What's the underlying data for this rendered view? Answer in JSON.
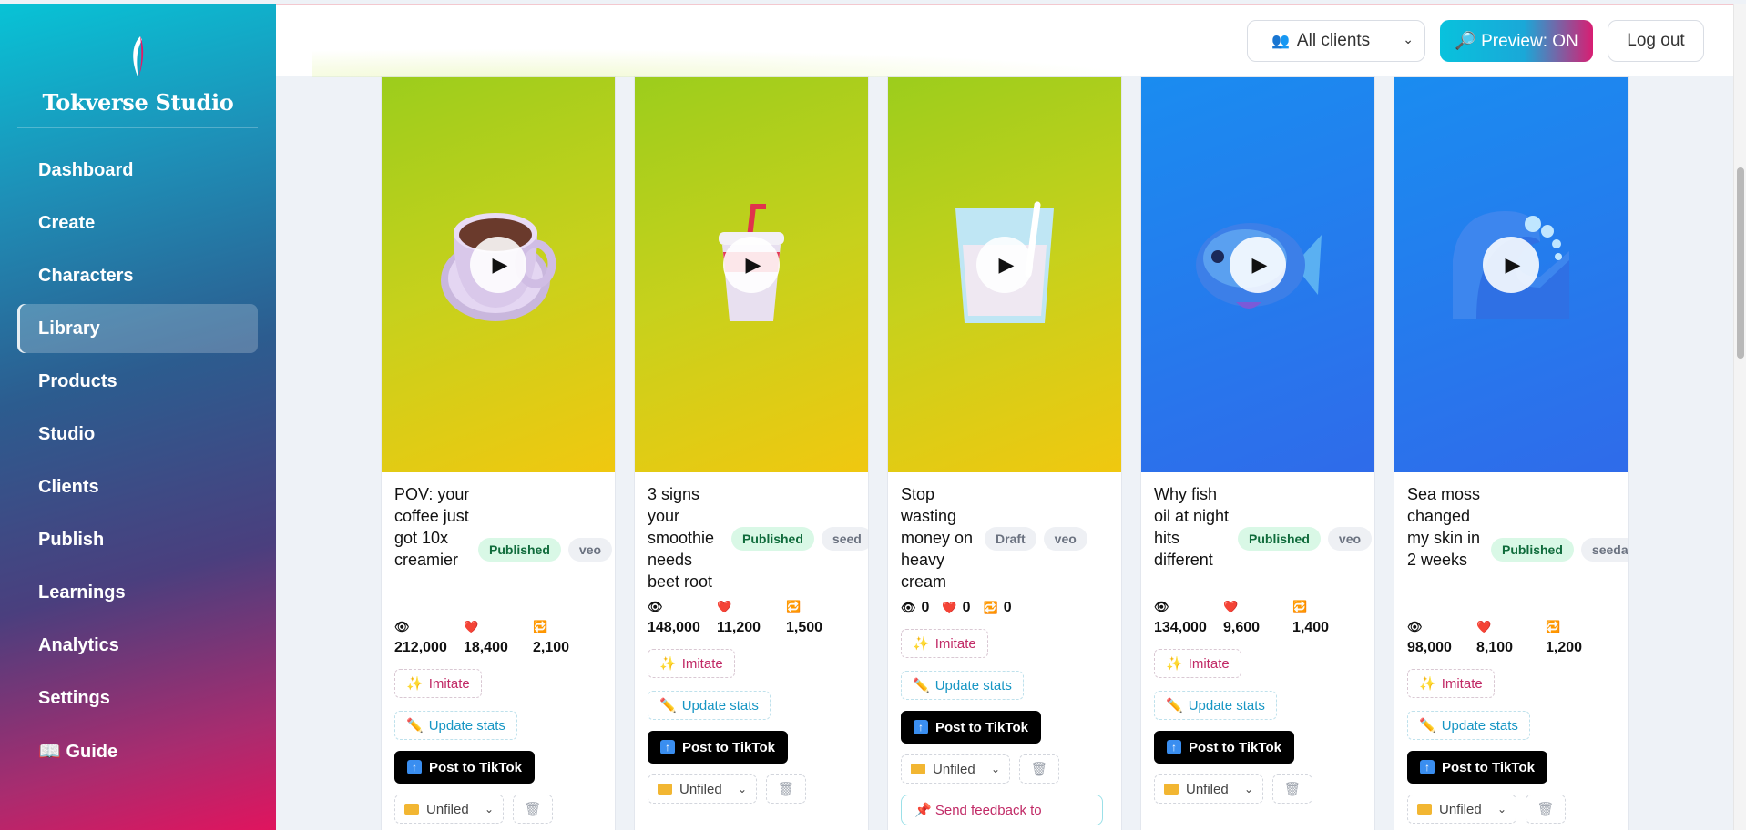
{
  "app": {
    "name": "Tokverse Studio"
  },
  "colors": {
    "accent_cyan": "#08c2dd",
    "accent_pink": "#d81e72",
    "published_bg": "#d9f8e6",
    "published_text": "#0f6b3b"
  },
  "sidebar": {
    "items": [
      {
        "label": "Dashboard",
        "active": false
      },
      {
        "label": "Create",
        "active": false
      },
      {
        "label": "Characters",
        "active": false
      },
      {
        "label": "Library",
        "active": true
      },
      {
        "label": "Products",
        "active": false
      },
      {
        "label": "Studio",
        "active": false
      },
      {
        "label": "Clients",
        "active": false
      },
      {
        "label": "Publish",
        "active": false
      },
      {
        "label": "Learnings",
        "active": false
      },
      {
        "label": "Analytics",
        "active": false
      },
      {
        "label": "Settings",
        "active": false
      },
      {
        "label": "📖 Guide",
        "active": false
      }
    ]
  },
  "topbar": {
    "client_select": "All clients",
    "preview_button": "🔎 Preview: ON",
    "logout_button": "Log out"
  },
  "card_labels": {
    "imitate": "Imitate",
    "update_stats": "Update stats",
    "post": "Post to TikTok",
    "folder": "Unfiled",
    "feedback": "Send feedback to"
  },
  "cards": [
    {
      "title": "POV: your coffee just got 10x creamier",
      "status": "Published",
      "model": "veo",
      "views": "212,000",
      "likes": "18,400",
      "shares": "2,100",
      "thumb": "coffee-cup",
      "bg": "lime"
    },
    {
      "title": "3 signs your smoothie needs beet root",
      "status": "Published",
      "model": "seed",
      "views": "148,000",
      "likes": "11,200",
      "shares": "1,500",
      "thumb": "smoothie-cup",
      "bg": "lime"
    },
    {
      "title": "Stop wasting money on heavy cream",
      "status": "Draft",
      "model": "veo",
      "views": "0",
      "likes": "0",
      "shares": "0",
      "thumb": "glass-of-milk",
      "bg": "lime"
    },
    {
      "title": "Why fish oil at night hits different",
      "status": "Published",
      "model": "veo",
      "views": "134,000",
      "likes": "9,600",
      "shares": "1,400",
      "thumb": "fish",
      "bg": "blue"
    },
    {
      "title": "Sea moss changed my skin in 2 weeks",
      "status": "Published",
      "model": "seeda",
      "views": "98,000",
      "likes": "8,100",
      "shares": "1,200",
      "thumb": "wave",
      "bg": "blue"
    }
  ]
}
